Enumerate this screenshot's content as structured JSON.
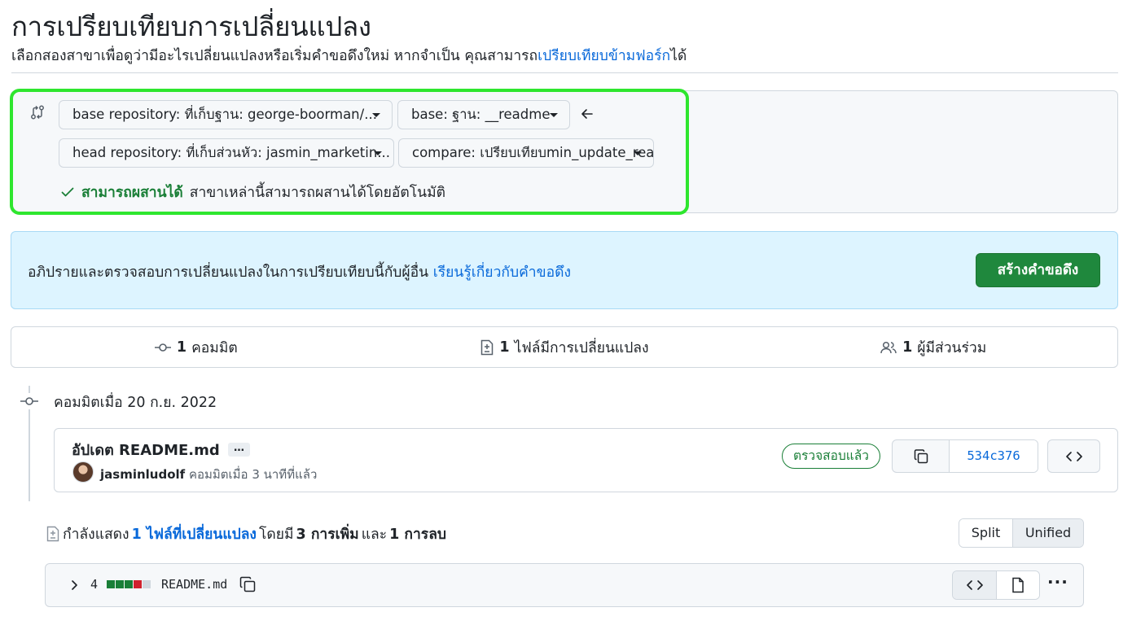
{
  "header": {
    "title": "การเปรียบเทียบการเปลี่ยนแปลง",
    "subtitle_prefix": "เลือกสองสาขาเพื่อดูว่ามีอะไรเปลี่ยนแปลงหรือเริ่มคำขอดึงใหม่ หากจำเป็น คุณสามารถ",
    "subtitle_link": "เปรียบเทียบข้ามฟอร์ก",
    "subtitle_suffix": "ได้"
  },
  "range": {
    "base_repository": "base repository: ที่เก็บฐาน: george-boorman/...",
    "base_branch": "base: ฐาน: __readme",
    "head_repository": "head repository: ที่เก็บส่วนหัว: jasmin_marketin...",
    "compare_branch": "compare: เปรียบเทียบmin_update_readme",
    "merge_status": "สามารถผสานได้",
    "merge_message": "สาขาเหล่านี้สามารถผสานได้โดยอัตโนมัติ"
  },
  "flash": {
    "text": "อภิปรายและตรวจสอบการเปลี่ยนแปลงในการเปรียบเทียบนี้กับผู้อื่น",
    "link": "เรียนรู้เกี่ยวกับคำขอดึง",
    "button": "สร้างคำขอดึง"
  },
  "stats": {
    "commits_count": "1",
    "commits_label": "คอมมิต",
    "files_count": "1",
    "files_label": "ไฟล์มีการเปลี่ยนแปลง",
    "contributors_count": "1",
    "contributors_label": "ผู้มีส่วนร่วม"
  },
  "commit": {
    "date_heading": "คอมมิตเมื่อ 20 ก.ย. 2022",
    "title": "อัปเดต README.md",
    "ellipsis": "…",
    "author": "jasminludolf",
    "meta": "คอมมิตเมื่อ 3 นาทีที่แล้ว",
    "verified": "ตรวจสอบแล้ว",
    "sha": "534c376"
  },
  "diff": {
    "prefix": "กำลังแสดง",
    "files_link": "1 ไฟล์ที่เปลี่ยนแปลง",
    "middle": "โดยมี",
    "additions": "3 การเพิ่ม",
    "and": "และ",
    "deletions": "1 การลบ",
    "view_split": "Split",
    "view_unified": "Unified",
    "view_selected": "Unified"
  },
  "file": {
    "changes": "4",
    "name": "README.md",
    "diffstat": [
      "added",
      "added",
      "added",
      "deleted",
      "neutral"
    ]
  },
  "colors": {
    "accent": "#0969da",
    "success": "#1a7f37",
    "primary_button": "#1f883d",
    "highlight": "#2ee62e",
    "deleted": "#cf222e",
    "neutral": "#d0d7de"
  }
}
